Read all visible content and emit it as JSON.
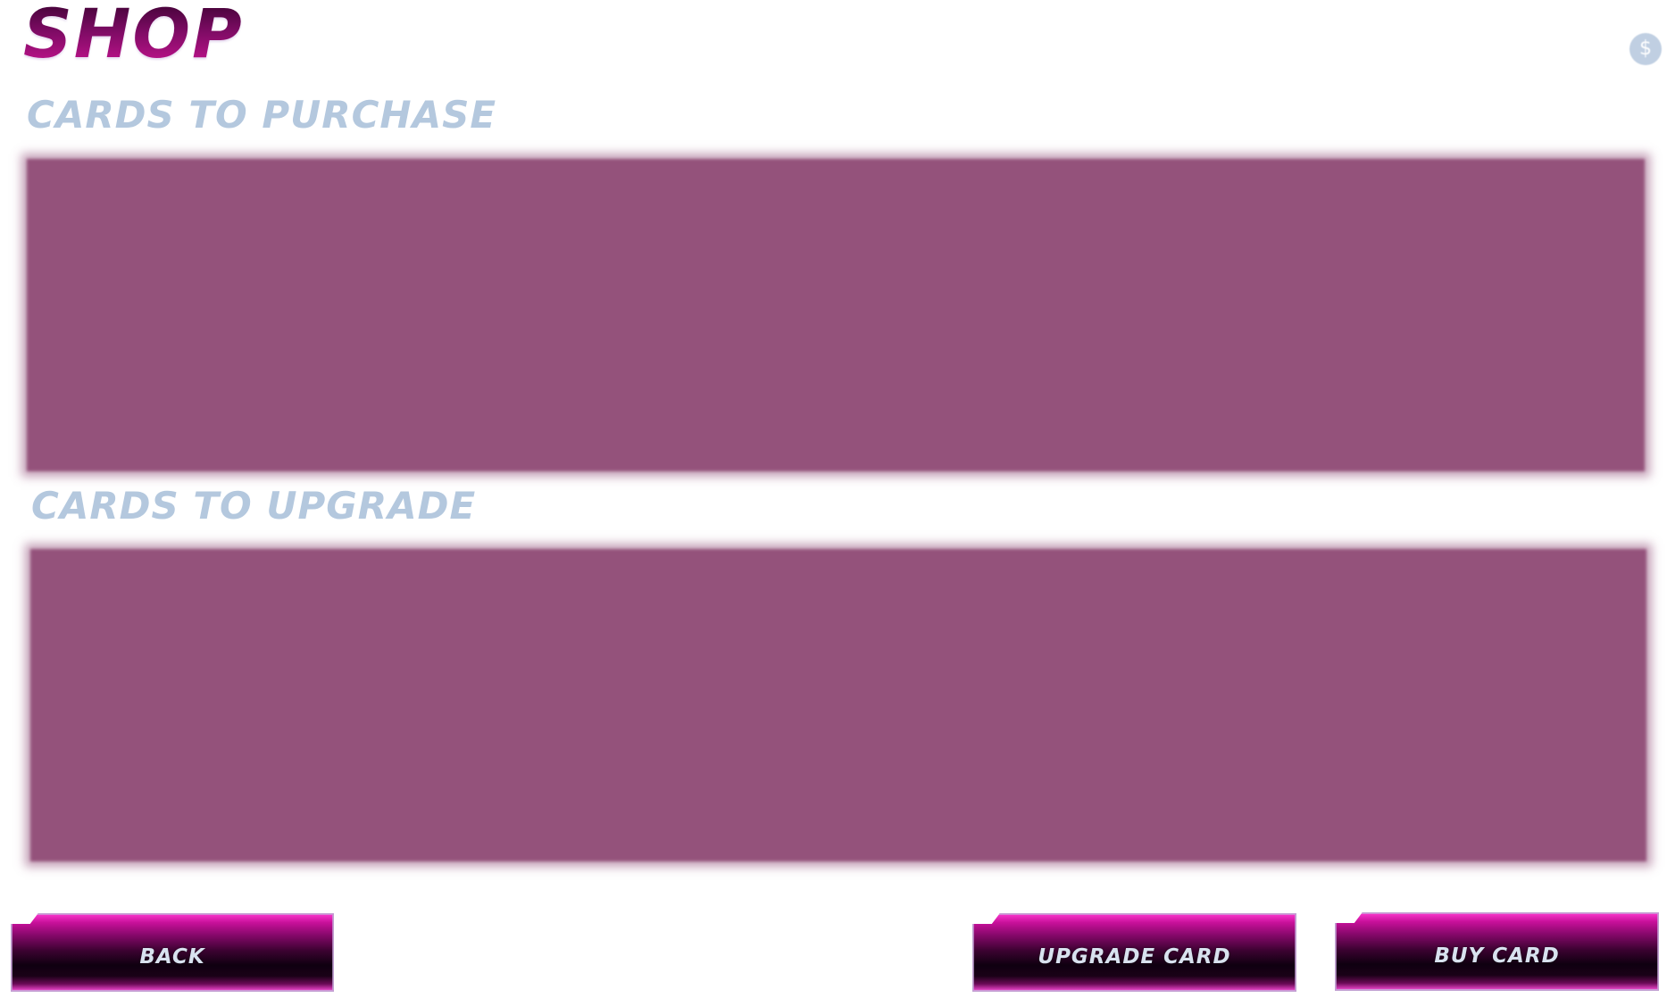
{
  "header": {
    "title": "SHOP",
    "currency_icon": "dollar-coin-icon",
    "currency_symbol": "$"
  },
  "sections": {
    "purchase_label": "CARDS TO PURCHASE",
    "upgrade_label": "CARDS TO UPGRADE"
  },
  "buttons": {
    "back": "BACK",
    "upgrade": "UPGRADE CARD",
    "buy": "BUY CARD"
  },
  "colors": {
    "title_gradient_dark": "#3d0232",
    "title_gradient_light": "#c5138f",
    "section_label": "#b4c8de",
    "panel": "#94527b",
    "button_magenta": "#c8109a",
    "button_dark": "#0f0010",
    "coin": "#c0cfe2"
  }
}
